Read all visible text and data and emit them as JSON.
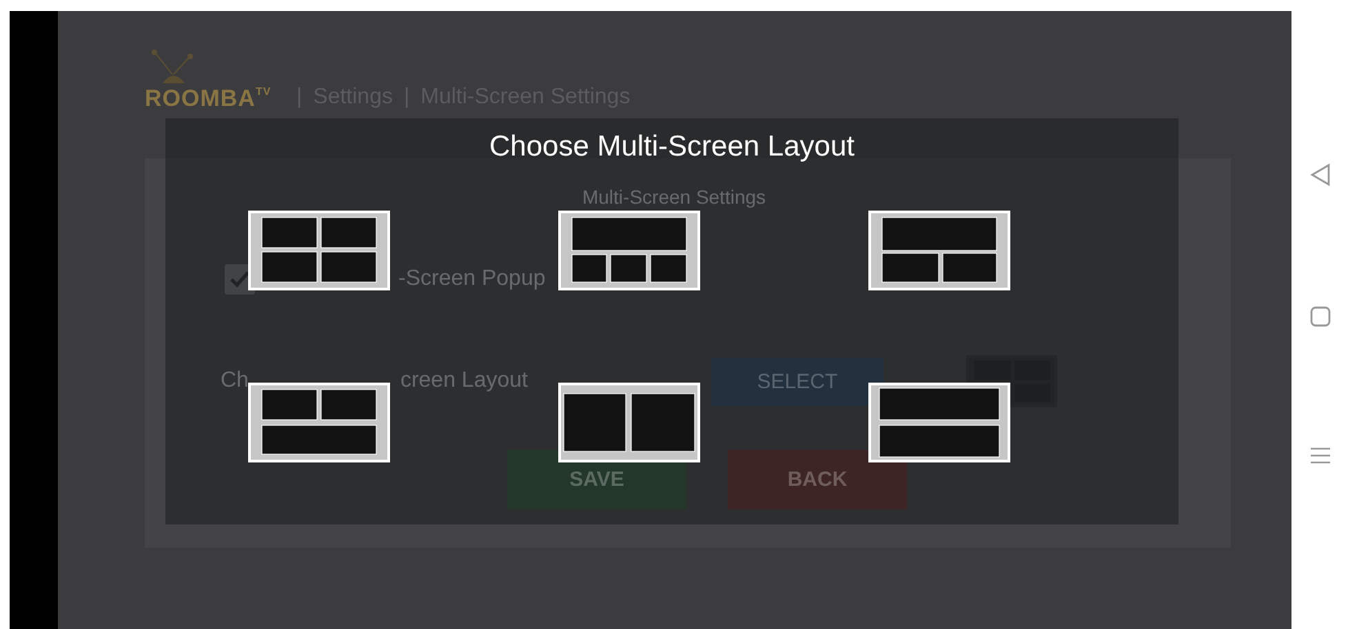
{
  "header": {
    "logo": {
      "text": "ROOMBA",
      "superscript": "TV"
    },
    "breadcrumbs": [
      {
        "separator": "|",
        "label": "Settings"
      },
      {
        "separator": "|",
        "label": "Multi-Screen Settings"
      }
    ]
  },
  "settings_panel": {
    "title": "Multi-Screen Settings",
    "popup_option": {
      "label": "-Screen Popup",
      "checked": true
    },
    "layout_label_parts": [
      "Ch",
      "creen Layout"
    ],
    "select_button": "SELECT",
    "buttons": [
      {
        "label": "SAVE",
        "kind": "save"
      },
      {
        "label": "BACK",
        "kind": "back"
      }
    ]
  },
  "dialog": {
    "title": "Choose Multi-Screen Layout",
    "layouts": [
      {
        "kind": "quad"
      },
      {
        "kind": "top-three"
      },
      {
        "kind": "top-two"
      },
      {
        "kind": "two-top"
      },
      {
        "kind": "side-by-side"
      },
      {
        "kind": "stacked"
      }
    ]
  }
}
